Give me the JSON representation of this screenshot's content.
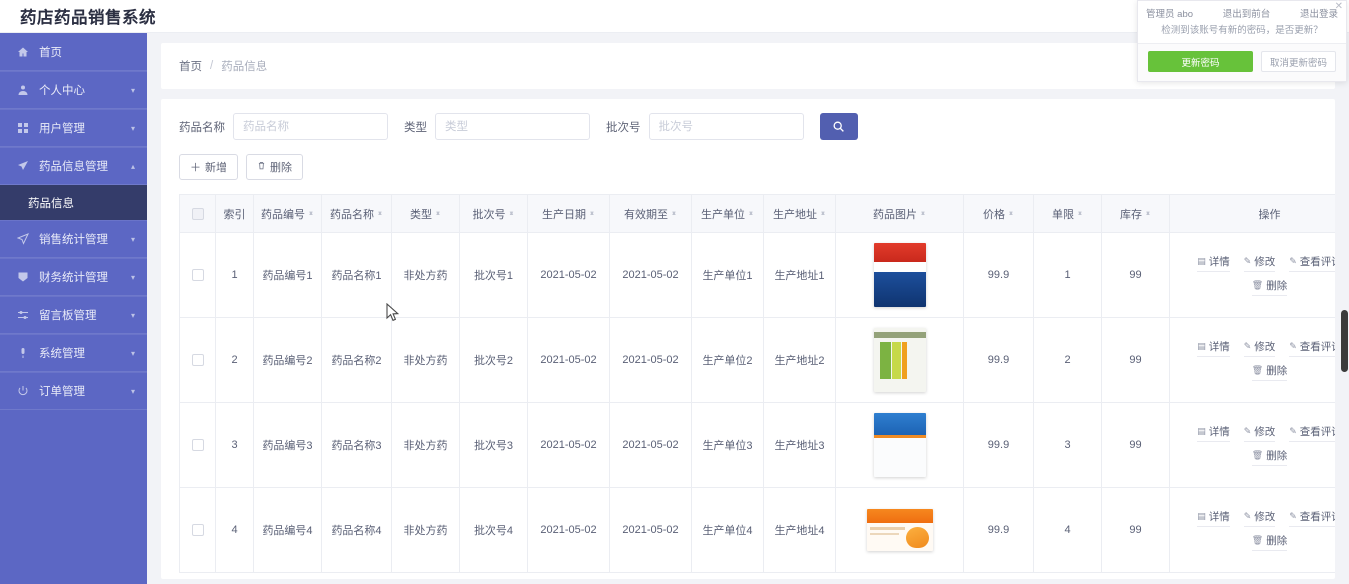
{
  "header": {
    "title": "药店药品销售系统"
  },
  "user_popup": {
    "role_label": "管理员",
    "username": "abo",
    "exit_front_label": "退出到前台",
    "logout_label": "退出登录",
    "close_icon": "close-icon",
    "message": "检测到该账号有新的密码，是否更新？",
    "confirm_label": "更新密码",
    "cancel_label": "取消更新密码",
    "confirm_color": "#67c23a"
  },
  "sidebar": {
    "bg_color": "#5c67c4",
    "active_color": "#343c6a",
    "items": [
      {
        "label": "首页",
        "icon": "home-icon",
        "has_arrow": false,
        "arrow": ""
      },
      {
        "label": "个人中心",
        "icon": "user-icon",
        "has_arrow": true,
        "arrow": "▾"
      },
      {
        "label": "用户管理",
        "icon": "grid-icon",
        "has_arrow": true,
        "arrow": "▾"
      },
      {
        "label": "药品信息管理",
        "icon": "send-icon",
        "has_arrow": true,
        "arrow": "▴"
      },
      {
        "label": "销售统计管理",
        "icon": "navigate-icon",
        "has_arrow": true,
        "arrow": "▾"
      },
      {
        "label": "财务统计管理",
        "icon": "shield-icon",
        "has_arrow": true,
        "arrow": "▾"
      },
      {
        "label": "留言板管理",
        "icon": "sliders-icon",
        "has_arrow": true,
        "arrow": "▾"
      },
      {
        "label": "系统管理",
        "icon": "mic-icon",
        "has_arrow": true,
        "arrow": "▾"
      },
      {
        "label": "订单管理",
        "icon": "power-icon",
        "has_arrow": true,
        "arrow": "▾"
      }
    ],
    "sub_item": {
      "label": "药品信息",
      "parent_index": 3
    }
  },
  "breadcrumb": {
    "home": "首页",
    "separator": "/",
    "current": "药品信息"
  },
  "search": {
    "name_label": "药品名称",
    "name_placeholder": "药品名称",
    "name_value": "",
    "type_label": "类型",
    "type_placeholder": "类型",
    "type_value": "",
    "batch_label": "批次号",
    "batch_placeholder": "批次号",
    "batch_value": "",
    "search_icon": "search-icon",
    "button_color": "#525fb0"
  },
  "toolbar": {
    "add_label": "新增",
    "add_icon": "plus-icon",
    "delete_label": "删除",
    "delete_icon": "trash-icon"
  },
  "table": {
    "columns": [
      {
        "key": "checkbox",
        "label": "",
        "sortable": false
      },
      {
        "key": "index",
        "label": "索引",
        "sortable": false
      },
      {
        "key": "code",
        "label": "药品编号",
        "sortable": true
      },
      {
        "key": "name",
        "label": "药品名称",
        "sortable": true
      },
      {
        "key": "type",
        "label": "类型",
        "sortable": true
      },
      {
        "key": "batch",
        "label": "批次号",
        "sortable": true
      },
      {
        "key": "prod_date",
        "label": "生产日期",
        "sortable": true
      },
      {
        "key": "expiry",
        "label": "有效期至",
        "sortable": true
      },
      {
        "key": "maker",
        "label": "生产单位",
        "sortable": true
      },
      {
        "key": "address",
        "label": "生产地址",
        "sortable": true
      },
      {
        "key": "image",
        "label": "药品图片",
        "sortable": true
      },
      {
        "key": "price",
        "label": "价格",
        "sortable": true
      },
      {
        "key": "limit",
        "label": "单限",
        "sortable": true
      },
      {
        "key": "stock",
        "label": "库存",
        "sortable": true
      },
      {
        "key": "ops",
        "label": "操作",
        "sortable": false
      }
    ],
    "rows": [
      {
        "index": "1",
        "code": "药品编号1",
        "name": "药品名称1",
        "type": "非处方药",
        "batch": "批次号1",
        "prod_date": "2021-05-02",
        "expiry": "2021-05-02",
        "maker": "生产单位1",
        "address": "生产地址1",
        "image": "medicine-box-red-blue",
        "price": "99.9",
        "limit": "1",
        "stock": "99"
      },
      {
        "index": "2",
        "code": "药品编号2",
        "name": "药品名称2",
        "type": "非处方药",
        "batch": "批次号2",
        "prod_date": "2021-05-02",
        "expiry": "2021-05-02",
        "maker": "生产单位2",
        "address": "生产地址2",
        "image": "medicine-box-green",
        "price": "99.9",
        "limit": "2",
        "stock": "99"
      },
      {
        "index": "3",
        "code": "药品编号3",
        "name": "药品名称3",
        "type": "非处方药",
        "batch": "批次号3",
        "prod_date": "2021-05-02",
        "expiry": "2021-05-02",
        "maker": "生产单位3",
        "address": "生产地址3",
        "image": "medicine-box-blue",
        "price": "99.9",
        "limit": "3",
        "stock": "99"
      },
      {
        "index": "4",
        "code": "药品编号4",
        "name": "药品名称4",
        "type": "非处方药",
        "batch": "批次号4",
        "prod_date": "2021-05-02",
        "expiry": "2021-05-02",
        "maker": "生产单位4",
        "address": "生产地址4",
        "image": "medicine-box-orange",
        "price": "99.9",
        "limit": "4",
        "stock": "99"
      }
    ],
    "row_actions": {
      "detail_label": "详情",
      "detail_icon": "document-icon",
      "edit_label": "修改",
      "edit_icon": "pencil-icon",
      "comment_label": "查看评论",
      "comment_icon": "pencil-icon",
      "delete_label": "删除",
      "delete_icon": "trash-icon"
    }
  }
}
